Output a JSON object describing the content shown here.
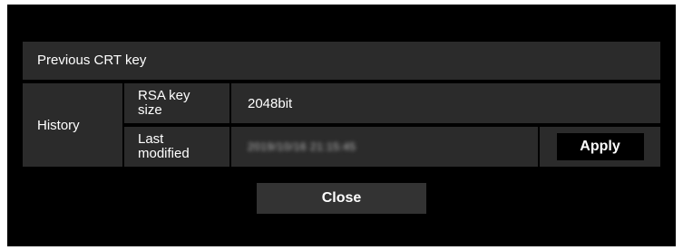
{
  "dialog": {
    "title": "Previous CRT key",
    "history_label": "History",
    "rows": [
      {
        "label": "RSA key\nsize",
        "value": "2048bit"
      },
      {
        "label": "Last\nmodified",
        "value": "2019/10/16 21:15:45"
      }
    ],
    "apply_label": "Apply",
    "close_label": "Close"
  },
  "colors": {
    "background": "#000000",
    "cell": "#2b2b2b",
    "close_button": "#333333",
    "text": "#ffffff"
  }
}
